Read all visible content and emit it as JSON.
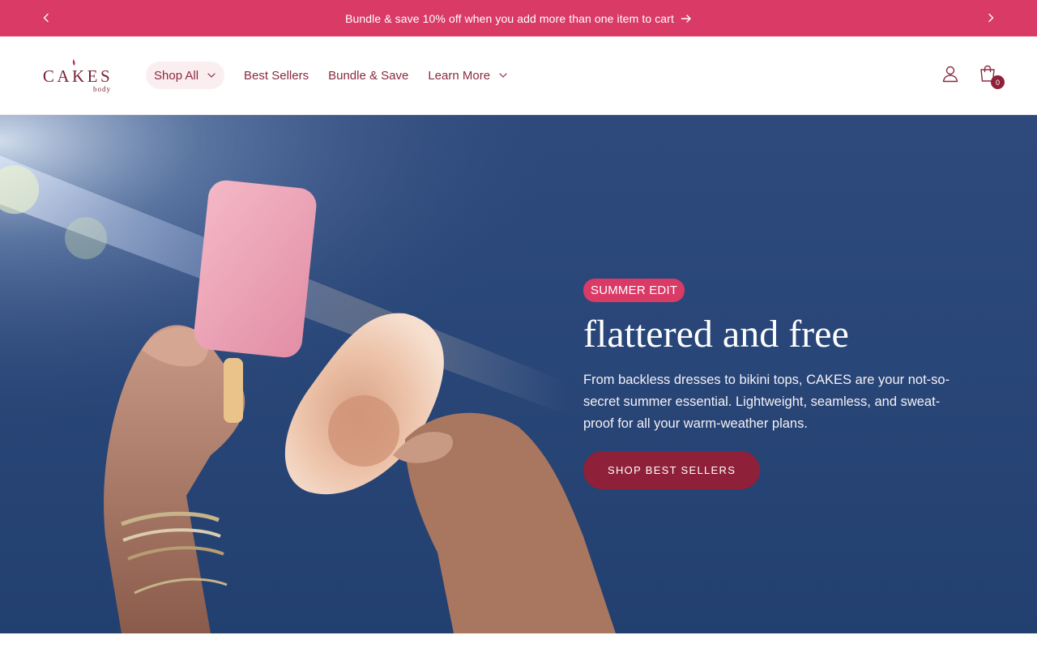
{
  "announcement": {
    "text": "Bundle & save 10% off when you add more than one item to cart",
    "prev_icon": "chevron-left-icon",
    "next_icon": "chevron-right-icon",
    "arrow_icon": "arrow-right-icon"
  },
  "header": {
    "logo_text": "CAKES",
    "logo_subtext": "body",
    "nav": [
      {
        "label": "Shop All",
        "has_dropdown": true
      },
      {
        "label": "Best Sellers",
        "has_dropdown": false
      },
      {
        "label": "Bundle & Save",
        "has_dropdown": false
      },
      {
        "label": "Learn More",
        "has_dropdown": true
      }
    ],
    "account_icon": "user-icon",
    "cart_icon": "shopping-bag-icon",
    "cart_count": "0"
  },
  "hero": {
    "badge": "SUMMER EDIT",
    "title": "flattered and free",
    "description": "From backless dresses to bikini tops, CAKES are your not-so-secret summer essential. Lightweight, seamless, and sweat-proof for all your warm-weather plans.",
    "cta_label": "SHOP BEST SELLERS"
  },
  "colors": {
    "announcement_bg": "#d93a66",
    "brand": "#8e2139",
    "hero_bg": "#294678"
  }
}
